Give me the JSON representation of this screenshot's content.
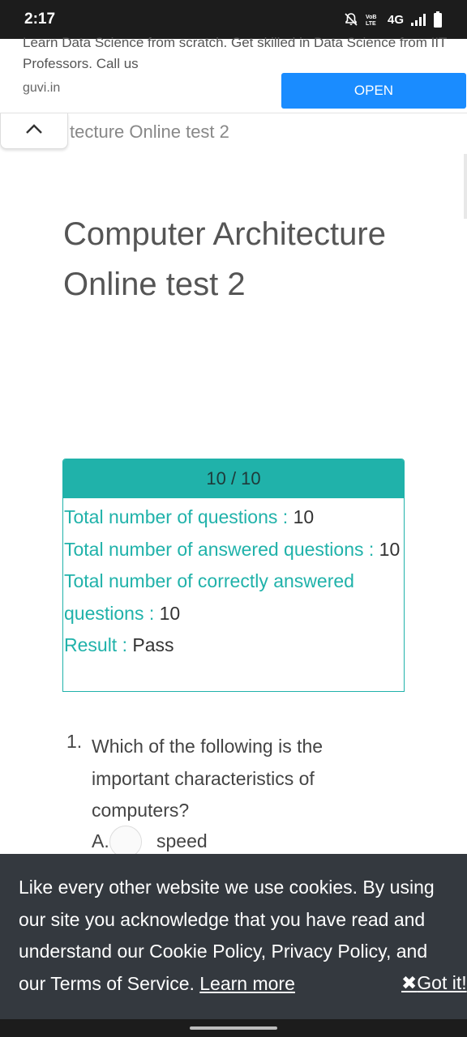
{
  "status_bar": {
    "time": "2:17",
    "network": "4G",
    "icons": [
      "mute-bell-icon",
      "volte-icon",
      "signal-icon",
      "battery-icon"
    ]
  },
  "ad": {
    "text": "Learn Data Science from scratch. Get skilled in Data Science from IIT Professors. Call us",
    "domain": "guvi.in",
    "open_label": "OPEN",
    "button_color": "#1a8cff"
  },
  "header": {
    "sticky_title": "tecture Online test 2",
    "collapse_icon": "chevron-up-icon"
  },
  "page": {
    "title": "Computer Architecture Online test 2"
  },
  "result": {
    "score": "10 / 10",
    "accent_color": "#20b2aa",
    "rows": [
      {
        "label": "Total number of questions : ",
        "value": "10"
      },
      {
        "label": "Total number of answered questions : ",
        "value": "10"
      },
      {
        "label": "Total number of correctly answered questions : ",
        "value": "10"
      },
      {
        "label": "Result : ",
        "value": "Pass"
      }
    ]
  },
  "question": {
    "number": "1.",
    "text": "Which of the following is the important characteristics of computers?",
    "options": [
      {
        "letter": "A.",
        "label": "speed"
      }
    ]
  },
  "cookie": {
    "text": "Like every other website we use cookies. By using our site you acknowledge that you have read and understand our Cookie Policy, Privacy Policy, and our Terms of Service. ",
    "learn_more": "Learn more",
    "got_it": "Got it!",
    "close_glyph": "✖"
  }
}
